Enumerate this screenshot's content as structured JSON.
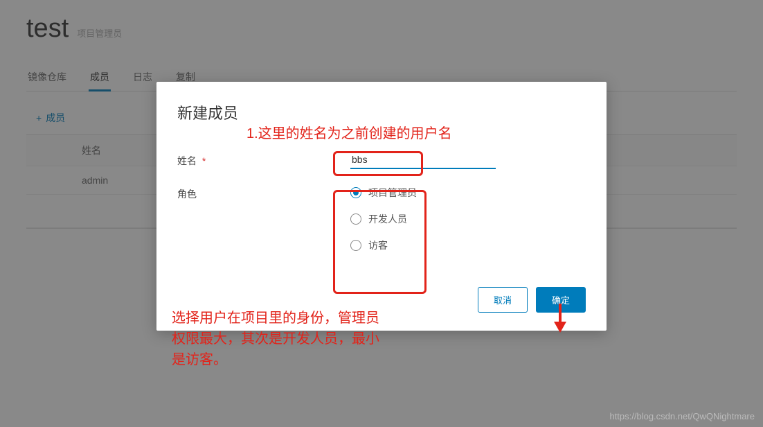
{
  "header": {
    "title": "test",
    "role": "项目管理员"
  },
  "tabs": [
    {
      "label": "镜像仓库",
      "active": false
    },
    {
      "label": "成员",
      "active": true
    },
    {
      "label": "日志",
      "active": false
    },
    {
      "label": "复制",
      "active": false
    }
  ],
  "toolbar": {
    "add_member_label": "成员",
    "plus": "+"
  },
  "table": {
    "header_name": "姓名",
    "rows": [
      {
        "name": "admin"
      }
    ]
  },
  "modal": {
    "title": "新建成员",
    "name_label": "姓名",
    "name_value": "bbs",
    "role_label": "角色",
    "roles": [
      {
        "label": "项目管理员",
        "selected": true
      },
      {
        "label": "开发人员",
        "selected": false
      },
      {
        "label": "访客",
        "selected": false
      }
    ],
    "cancel": "取消",
    "confirm": "确定"
  },
  "annotations": {
    "a1": "1.这里的姓名为之前创建的用户名",
    "a2_line1": "选择用户在项目里的身份，管理员",
    "a2_line2": "权限最大，其次是开发人员，最小",
    "a2_line3": "是访客。"
  },
  "watermark": "https://blog.csdn.net/QwQNightmare"
}
